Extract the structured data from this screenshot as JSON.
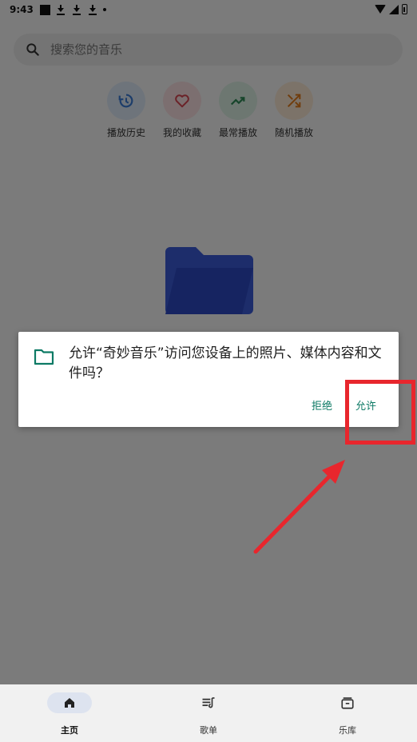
{
  "status_bar": {
    "time": "9:43"
  },
  "search": {
    "placeholder": "搜索您的音乐"
  },
  "quick_actions": [
    {
      "label": "播放历史",
      "icon": "history-icon",
      "color": "#3a7bd5",
      "bg": "#dde9f7"
    },
    {
      "label": "我的收藏",
      "icon": "heart-icon",
      "color": "#d64550",
      "bg": "#f8dfe1"
    },
    {
      "label": "最常播放",
      "icon": "trending-up-icon",
      "color": "#2e8b57",
      "bg": "#dbefe2"
    },
    {
      "label": "随机播放",
      "icon": "shuffle-icon",
      "color": "#e07b1a",
      "bg": "#f8e7d3"
    }
  ],
  "dialog": {
    "message": "允许“奇妙音乐”访问您设备上的照片、媒体内容和文件吗？",
    "deny_label": "拒绝",
    "allow_label": "允许",
    "accent": "#0d7a65"
  },
  "bottom_nav": [
    {
      "label": "主页",
      "icon": "home-icon",
      "active": true
    },
    {
      "label": "歌单",
      "icon": "playlist-icon",
      "active": false
    },
    {
      "label": "乐库",
      "icon": "library-icon",
      "active": false
    }
  ],
  "annotation": {
    "color": "#e8262d"
  }
}
